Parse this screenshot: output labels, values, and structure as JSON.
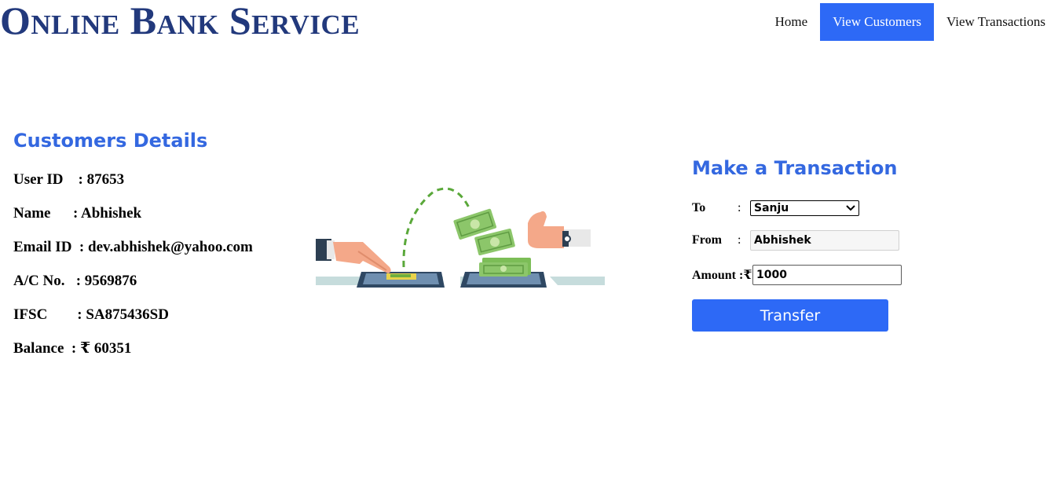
{
  "colors": {
    "brand": "#22397c",
    "accent": "#2d69f6",
    "heading": "#3468e0",
    "nav_text": "#111111"
  },
  "header": {
    "brand": "Online Bank Service",
    "nav": [
      {
        "label": "Home",
        "active": false
      },
      {
        "label": "View Customers",
        "active": true
      },
      {
        "label": "View Transactions",
        "active": false
      }
    ]
  },
  "details": {
    "title": "Customers Details",
    "rows": [
      "User ID    : 87653",
      "Name      : Abhishek",
      "Email ID  : dev.abhishek@yahoo.com",
      "A/C No.   : 9569876",
      "IFSC        : SA875436SD",
      "Balance  : ₹ 60351"
    ]
  },
  "illustration": {
    "icon": "money-transfer-illustration"
  },
  "transaction": {
    "title": "Make a Transaction",
    "to_label": "To",
    "to_colon": ":",
    "to_selected": "Sanju",
    "from_label": "From",
    "from_colon": ":",
    "from_value": "Abhishek",
    "amount_label": "Amount :₹",
    "amount_value": "1000",
    "transfer_label": "Transfer"
  }
}
